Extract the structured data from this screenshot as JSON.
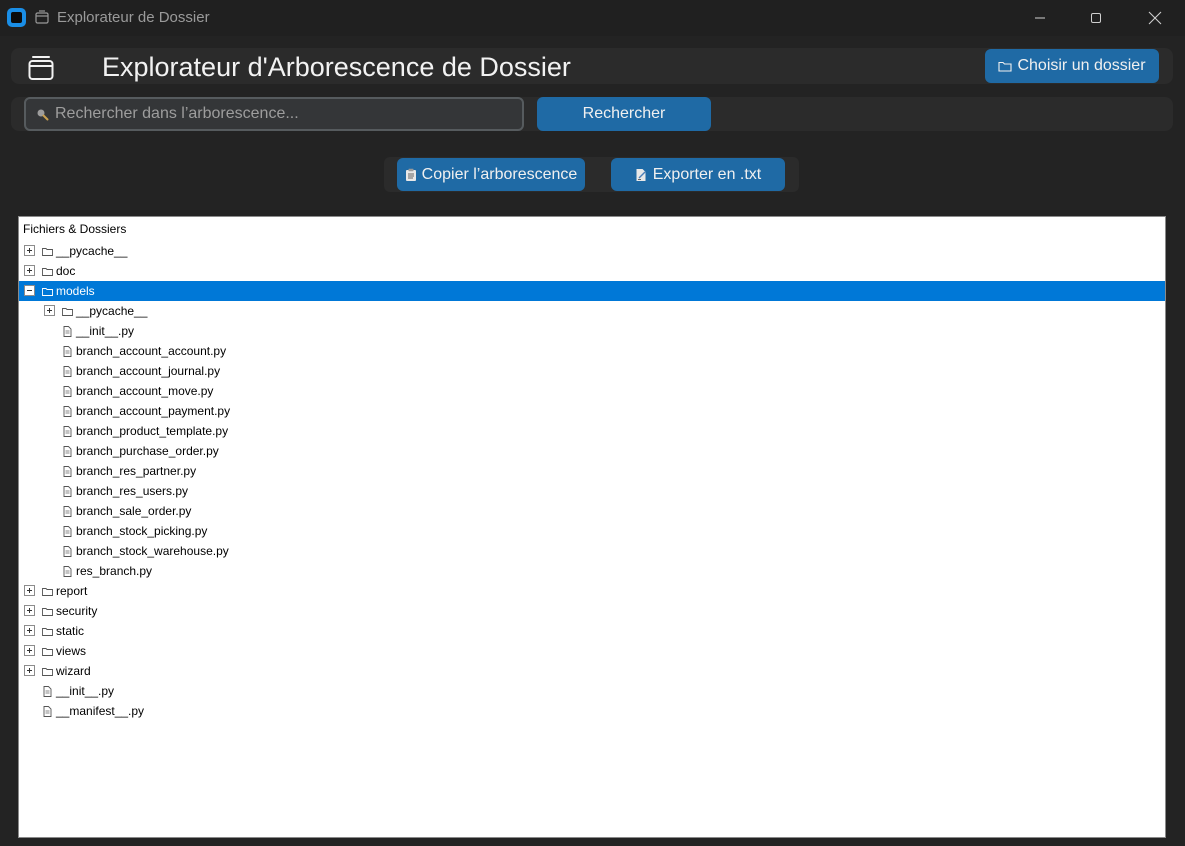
{
  "window": {
    "title": "Explorateur de Dossier"
  },
  "header": {
    "title": "Explorateur d'Arborescence de Dossier",
    "choose_folder_label": "Choisir un dossier"
  },
  "search": {
    "placeholder": "Rechercher dans l’arborescence...",
    "button_label": "Rechercher"
  },
  "actions": {
    "copy_label": "Copier l’arborescence",
    "export_label": "Exporter en .txt"
  },
  "tree": {
    "heading": "Fichiers & Dossiers",
    "items": [
      {
        "label": "__pycache__",
        "type": "folder",
        "level": 0,
        "expander": "plus"
      },
      {
        "label": "doc",
        "type": "folder",
        "level": 0,
        "expander": "plus"
      },
      {
        "label": "models",
        "type": "folder",
        "level": 0,
        "expander": "minus",
        "selected": true
      },
      {
        "label": "__pycache__",
        "type": "folder",
        "level": 1,
        "expander": "plus"
      },
      {
        "label": "__init__.py",
        "type": "file",
        "level": 1
      },
      {
        "label": "branch_account_account.py",
        "type": "file",
        "level": 1
      },
      {
        "label": "branch_account_journal.py",
        "type": "file",
        "level": 1
      },
      {
        "label": "branch_account_move.py",
        "type": "file",
        "level": 1
      },
      {
        "label": "branch_account_payment.py",
        "type": "file",
        "level": 1
      },
      {
        "label": "branch_product_template.py",
        "type": "file",
        "level": 1
      },
      {
        "label": "branch_purchase_order.py",
        "type": "file",
        "level": 1
      },
      {
        "label": "branch_res_partner.py",
        "type": "file",
        "level": 1
      },
      {
        "label": "branch_res_users.py",
        "type": "file",
        "level": 1
      },
      {
        "label": "branch_sale_order.py",
        "type": "file",
        "level": 1
      },
      {
        "label": "branch_stock_picking.py",
        "type": "file",
        "level": 1
      },
      {
        "label": "branch_stock_warehouse.py",
        "type": "file",
        "level": 1
      },
      {
        "label": "res_branch.py",
        "type": "file",
        "level": 1
      },
      {
        "label": "report",
        "type": "folder",
        "level": 0,
        "expander": "plus"
      },
      {
        "label": "security",
        "type": "folder",
        "level": 0,
        "expander": "plus"
      },
      {
        "label": "static",
        "type": "folder",
        "level": 0,
        "expander": "plus"
      },
      {
        "label": "views",
        "type": "folder",
        "level": 0,
        "expander": "plus"
      },
      {
        "label": "wizard",
        "type": "folder",
        "level": 0,
        "expander": "plus"
      },
      {
        "label": "__init__.py",
        "type": "file",
        "level": 0
      },
      {
        "label": "__manifest__.py",
        "type": "file",
        "level": 0
      }
    ]
  },
  "colors": {
    "background": "#232323",
    "panel": "#2b2b2b",
    "accent": "#1f6aa5",
    "selection": "#0078d7"
  }
}
